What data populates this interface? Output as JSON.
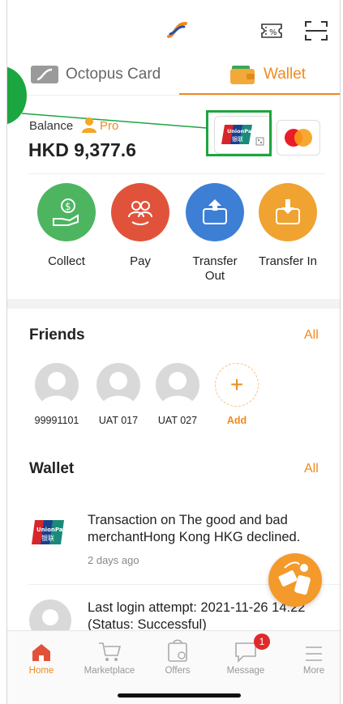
{
  "top_bar": {
    "brand_icon": "octopus-swirl-logo",
    "ticket_icon": "discount-ticket-icon",
    "scan_icon": "scan-icon"
  },
  "tabs": [
    {
      "label": "Octopus Card",
      "active": false
    },
    {
      "label": "Wallet",
      "active": true
    }
  ],
  "balance": {
    "label": "Balance",
    "badge": "Pro",
    "amount": "HKD 9,377.6"
  },
  "cards": {
    "unionpay": {
      "brand": "UnionPay",
      "cn": "银联"
    },
    "mastercard": {
      "brand": "mastercard"
    }
  },
  "actions": [
    {
      "label": "Collect",
      "color": "#4db560"
    },
    {
      "label": "Pay",
      "color": "#e0533a"
    },
    {
      "label": "Transfer Out",
      "color": "#3e7fd6"
    },
    {
      "label": "Transfer In",
      "color": "#f0a331"
    }
  ],
  "friends": {
    "title": "Friends",
    "all": "All",
    "items": [
      "99991101",
      "UAT 017",
      "UAT 027"
    ],
    "add_label": "Add",
    "add_symbol": "+"
  },
  "wallet": {
    "title": "Wallet",
    "all": "All",
    "messages": [
      {
        "text": "Transaction on The good and bad merchantHong Kong HKG declined.",
        "time": "2 days ago"
      },
      {
        "text": "Last login attempt: 2021-11-26 14:22 (Status: Successful)",
        "time": ""
      }
    ]
  },
  "nav": [
    {
      "label": "Home",
      "active": true
    },
    {
      "label": "Marketplace",
      "active": false
    },
    {
      "label": "Offers",
      "active": false
    },
    {
      "label": "Message",
      "active": false,
      "badge": "1"
    },
    {
      "label": "More",
      "active": false
    }
  ],
  "colors": {
    "accent": "#f08a1e",
    "highlight": "#1ca640"
  }
}
